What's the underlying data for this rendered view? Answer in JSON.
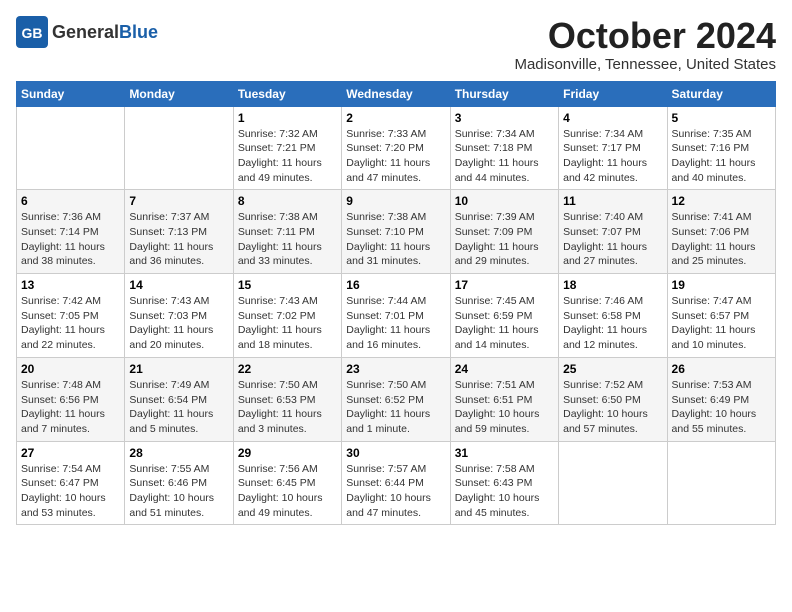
{
  "header": {
    "logo_general": "General",
    "logo_blue": "Blue",
    "month_title": "October 2024",
    "location": "Madisonville, Tennessee, United States"
  },
  "days_of_week": [
    "Sunday",
    "Monday",
    "Tuesday",
    "Wednesday",
    "Thursday",
    "Friday",
    "Saturday"
  ],
  "weeks": [
    [
      {
        "num": "",
        "sunrise": "",
        "sunset": "",
        "daylight": ""
      },
      {
        "num": "",
        "sunrise": "",
        "sunset": "",
        "daylight": ""
      },
      {
        "num": "1",
        "sunrise": "Sunrise: 7:32 AM",
        "sunset": "Sunset: 7:21 PM",
        "daylight": "Daylight: 11 hours and 49 minutes."
      },
      {
        "num": "2",
        "sunrise": "Sunrise: 7:33 AM",
        "sunset": "Sunset: 7:20 PM",
        "daylight": "Daylight: 11 hours and 47 minutes."
      },
      {
        "num": "3",
        "sunrise": "Sunrise: 7:34 AM",
        "sunset": "Sunset: 7:18 PM",
        "daylight": "Daylight: 11 hours and 44 minutes."
      },
      {
        "num": "4",
        "sunrise": "Sunrise: 7:34 AM",
        "sunset": "Sunset: 7:17 PM",
        "daylight": "Daylight: 11 hours and 42 minutes."
      },
      {
        "num": "5",
        "sunrise": "Sunrise: 7:35 AM",
        "sunset": "Sunset: 7:16 PM",
        "daylight": "Daylight: 11 hours and 40 minutes."
      }
    ],
    [
      {
        "num": "6",
        "sunrise": "Sunrise: 7:36 AM",
        "sunset": "Sunset: 7:14 PM",
        "daylight": "Daylight: 11 hours and 38 minutes."
      },
      {
        "num": "7",
        "sunrise": "Sunrise: 7:37 AM",
        "sunset": "Sunset: 7:13 PM",
        "daylight": "Daylight: 11 hours and 36 minutes."
      },
      {
        "num": "8",
        "sunrise": "Sunrise: 7:38 AM",
        "sunset": "Sunset: 7:11 PM",
        "daylight": "Daylight: 11 hours and 33 minutes."
      },
      {
        "num": "9",
        "sunrise": "Sunrise: 7:38 AM",
        "sunset": "Sunset: 7:10 PM",
        "daylight": "Daylight: 11 hours and 31 minutes."
      },
      {
        "num": "10",
        "sunrise": "Sunrise: 7:39 AM",
        "sunset": "Sunset: 7:09 PM",
        "daylight": "Daylight: 11 hours and 29 minutes."
      },
      {
        "num": "11",
        "sunrise": "Sunrise: 7:40 AM",
        "sunset": "Sunset: 7:07 PM",
        "daylight": "Daylight: 11 hours and 27 minutes."
      },
      {
        "num": "12",
        "sunrise": "Sunrise: 7:41 AM",
        "sunset": "Sunset: 7:06 PM",
        "daylight": "Daylight: 11 hours and 25 minutes."
      }
    ],
    [
      {
        "num": "13",
        "sunrise": "Sunrise: 7:42 AM",
        "sunset": "Sunset: 7:05 PM",
        "daylight": "Daylight: 11 hours and 22 minutes."
      },
      {
        "num": "14",
        "sunrise": "Sunrise: 7:43 AM",
        "sunset": "Sunset: 7:03 PM",
        "daylight": "Daylight: 11 hours and 20 minutes."
      },
      {
        "num": "15",
        "sunrise": "Sunrise: 7:43 AM",
        "sunset": "Sunset: 7:02 PM",
        "daylight": "Daylight: 11 hours and 18 minutes."
      },
      {
        "num": "16",
        "sunrise": "Sunrise: 7:44 AM",
        "sunset": "Sunset: 7:01 PM",
        "daylight": "Daylight: 11 hours and 16 minutes."
      },
      {
        "num": "17",
        "sunrise": "Sunrise: 7:45 AM",
        "sunset": "Sunset: 6:59 PM",
        "daylight": "Daylight: 11 hours and 14 minutes."
      },
      {
        "num": "18",
        "sunrise": "Sunrise: 7:46 AM",
        "sunset": "Sunset: 6:58 PM",
        "daylight": "Daylight: 11 hours and 12 minutes."
      },
      {
        "num": "19",
        "sunrise": "Sunrise: 7:47 AM",
        "sunset": "Sunset: 6:57 PM",
        "daylight": "Daylight: 11 hours and 10 minutes."
      }
    ],
    [
      {
        "num": "20",
        "sunrise": "Sunrise: 7:48 AM",
        "sunset": "Sunset: 6:56 PM",
        "daylight": "Daylight: 11 hours and 7 minutes."
      },
      {
        "num": "21",
        "sunrise": "Sunrise: 7:49 AM",
        "sunset": "Sunset: 6:54 PM",
        "daylight": "Daylight: 11 hours and 5 minutes."
      },
      {
        "num": "22",
        "sunrise": "Sunrise: 7:50 AM",
        "sunset": "Sunset: 6:53 PM",
        "daylight": "Daylight: 11 hours and 3 minutes."
      },
      {
        "num": "23",
        "sunrise": "Sunrise: 7:50 AM",
        "sunset": "Sunset: 6:52 PM",
        "daylight": "Daylight: 11 hours and 1 minute."
      },
      {
        "num": "24",
        "sunrise": "Sunrise: 7:51 AM",
        "sunset": "Sunset: 6:51 PM",
        "daylight": "Daylight: 10 hours and 59 minutes."
      },
      {
        "num": "25",
        "sunrise": "Sunrise: 7:52 AM",
        "sunset": "Sunset: 6:50 PM",
        "daylight": "Daylight: 10 hours and 57 minutes."
      },
      {
        "num": "26",
        "sunrise": "Sunrise: 7:53 AM",
        "sunset": "Sunset: 6:49 PM",
        "daylight": "Daylight: 10 hours and 55 minutes."
      }
    ],
    [
      {
        "num": "27",
        "sunrise": "Sunrise: 7:54 AM",
        "sunset": "Sunset: 6:47 PM",
        "daylight": "Daylight: 10 hours and 53 minutes."
      },
      {
        "num": "28",
        "sunrise": "Sunrise: 7:55 AM",
        "sunset": "Sunset: 6:46 PM",
        "daylight": "Daylight: 10 hours and 51 minutes."
      },
      {
        "num": "29",
        "sunrise": "Sunrise: 7:56 AM",
        "sunset": "Sunset: 6:45 PM",
        "daylight": "Daylight: 10 hours and 49 minutes."
      },
      {
        "num": "30",
        "sunrise": "Sunrise: 7:57 AM",
        "sunset": "Sunset: 6:44 PM",
        "daylight": "Daylight: 10 hours and 47 minutes."
      },
      {
        "num": "31",
        "sunrise": "Sunrise: 7:58 AM",
        "sunset": "Sunset: 6:43 PM",
        "daylight": "Daylight: 10 hours and 45 minutes."
      },
      {
        "num": "",
        "sunrise": "",
        "sunset": "",
        "daylight": ""
      },
      {
        "num": "",
        "sunrise": "",
        "sunset": "",
        "daylight": ""
      }
    ]
  ]
}
